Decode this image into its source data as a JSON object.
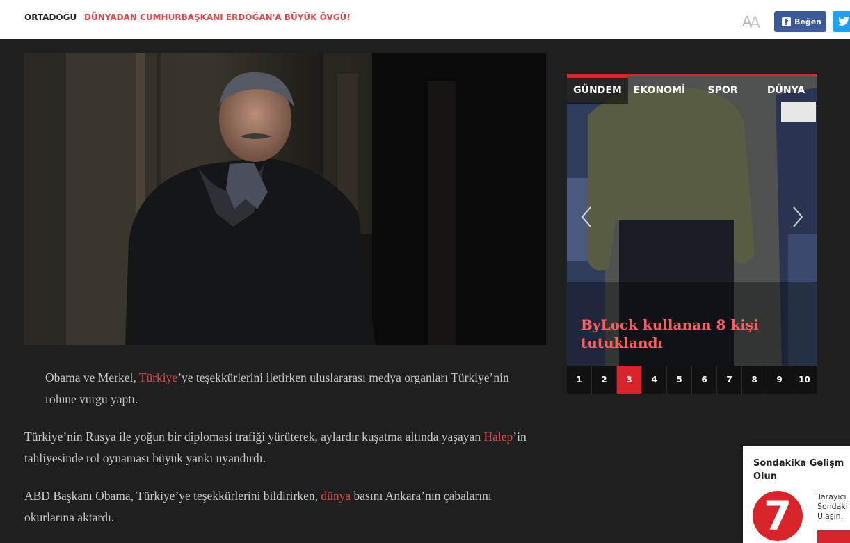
{
  "topbar": {
    "category": "ORTADOĞU",
    "headline": "DÜNYADAN CUMHURBAŞKANI ERDOĞAN'A BÜYÜK ÖVGÜ!",
    "font_size_icon": "font-size-icon",
    "facebook_label": "Beğen",
    "facebook_icon": "facebook-icon",
    "twitter_icon": "twitter-icon"
  },
  "article": {
    "lead_before": "Obama ve Merkel, ",
    "lead_link": "Türkiye",
    "lead_after": "’ye teşekkürlerini iletirken uluslararası medya organları Türkiye’nin rolüne vurgu yaptı.",
    "p1_before": "Türkiye’nin Rusya ile yoğun bir diplomasi trafiği yürüterek, aylardır kuşatma altında yaşayan ",
    "p1_link": "Halep",
    "p1_after": "’in tahliyesinde rol oynaması büyük yankı uyandırdı.",
    "p2_before": "ABD Başkanı Obama, Türkiye’ye teşekkürlerini bildirirken, ",
    "p2_link": "dünya",
    "p2_after": " basını Ankara’nın çabalarını okurlarına aktardı."
  },
  "slider": {
    "tabs": [
      "GÜNDEM",
      "EKONOMİ",
      "SPOR",
      "DÜNYA"
    ],
    "active_tab": 0,
    "slide_title": "ByLock kullanan 8 kişi tutuklandı",
    "pages": [
      "1",
      "2",
      "3",
      "4",
      "5",
      "6",
      "7",
      "8",
      "9",
      "10"
    ],
    "active_page": 2
  },
  "popup": {
    "title_line1": "Sondakika Gelişm",
    "title_line2": "Olun",
    "logo_text": "7",
    "text_line1": "Tarayıcı",
    "text_line2": "Sondaki",
    "text_line3": "Ulaşın."
  },
  "colors": {
    "accent": "#d8232a",
    "link": "#e0474c",
    "background": "#1f1f1f",
    "facebook": "#3b5998",
    "twitter": "#1da1f2"
  }
}
